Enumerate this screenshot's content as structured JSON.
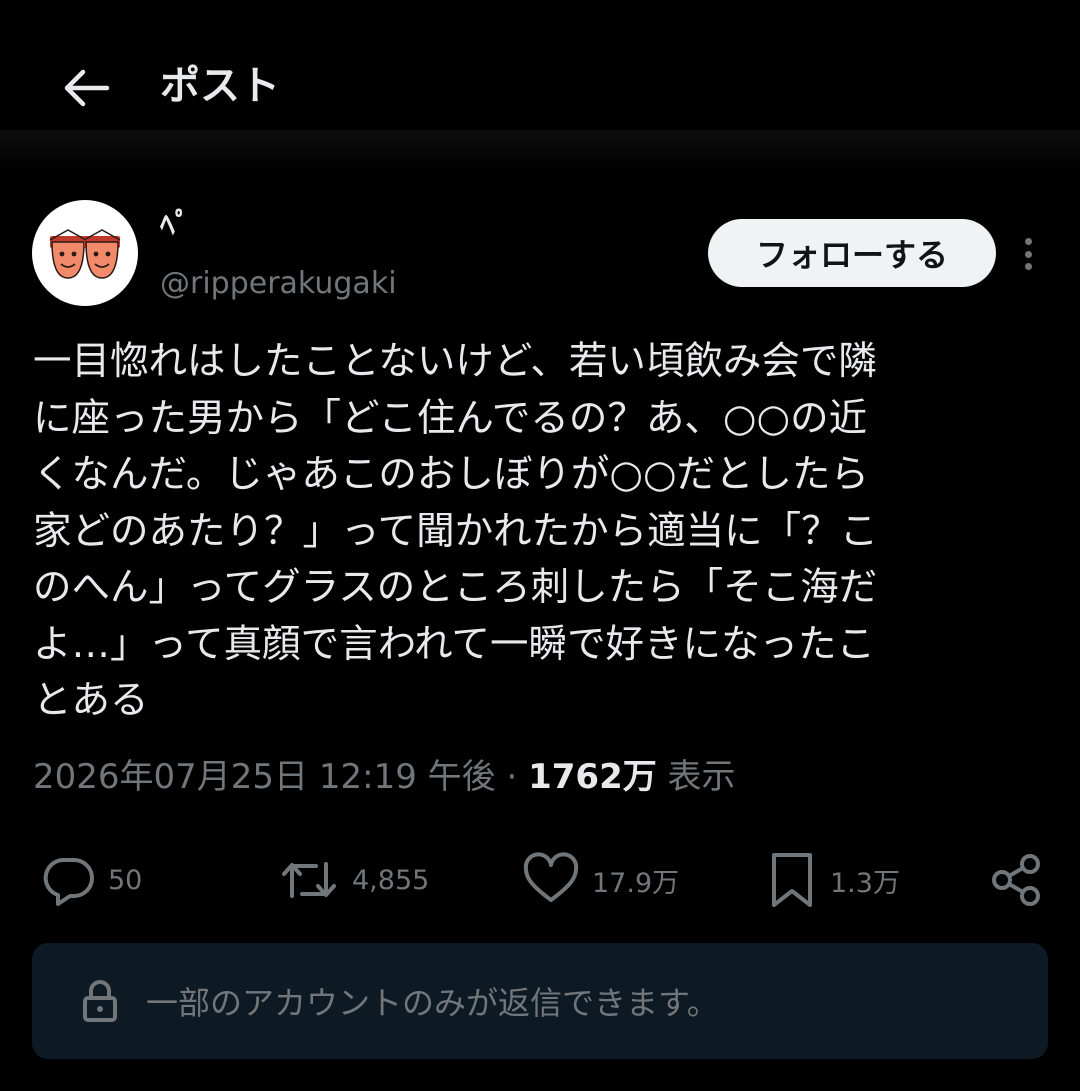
{
  "header": {
    "back_icon": "arrow-left-icon",
    "title": "ポスト"
  },
  "author": {
    "display_name": "ﾍﾟ",
    "handle": "@ripperakugaki",
    "follow_label": "フォローする",
    "more_icon": "vertical-ellipsis-icon"
  },
  "post": {
    "lines": [
      "一目惚れはしたことないけど、若い頃飲み会で隣",
      "に座った男から「どこ住んでるの？あ、○○の近",
      "くなんだ。じゃあこのおしぼりが○○だとしたら",
      "家どのあたり？」って聞かれたから適当に「？こ",
      "のへん」ってグラスのところ刺したら「そこ海だ",
      "よ…」って真顔で言われて一瞬で好きになったこ",
      "とある"
    ]
  },
  "meta": {
    "timestamp": "2026年07月25日 12:19 午後",
    "separator": "·",
    "views_count": "1762万",
    "views_label": "表示"
  },
  "actions": {
    "reply_count": "50",
    "retweet_count": "4,855",
    "like_count": "17.9万",
    "bookmark_count": "1.3万"
  },
  "reply_restriction": {
    "text": "一部のアカウントのみが返信できます。"
  },
  "colors": {
    "background": "#000000",
    "text_primary": "#e7e9ea",
    "text_secondary": "#71767b",
    "follow_button_bg": "#eff3f4",
    "restriction_bg": "#0e1a23"
  }
}
